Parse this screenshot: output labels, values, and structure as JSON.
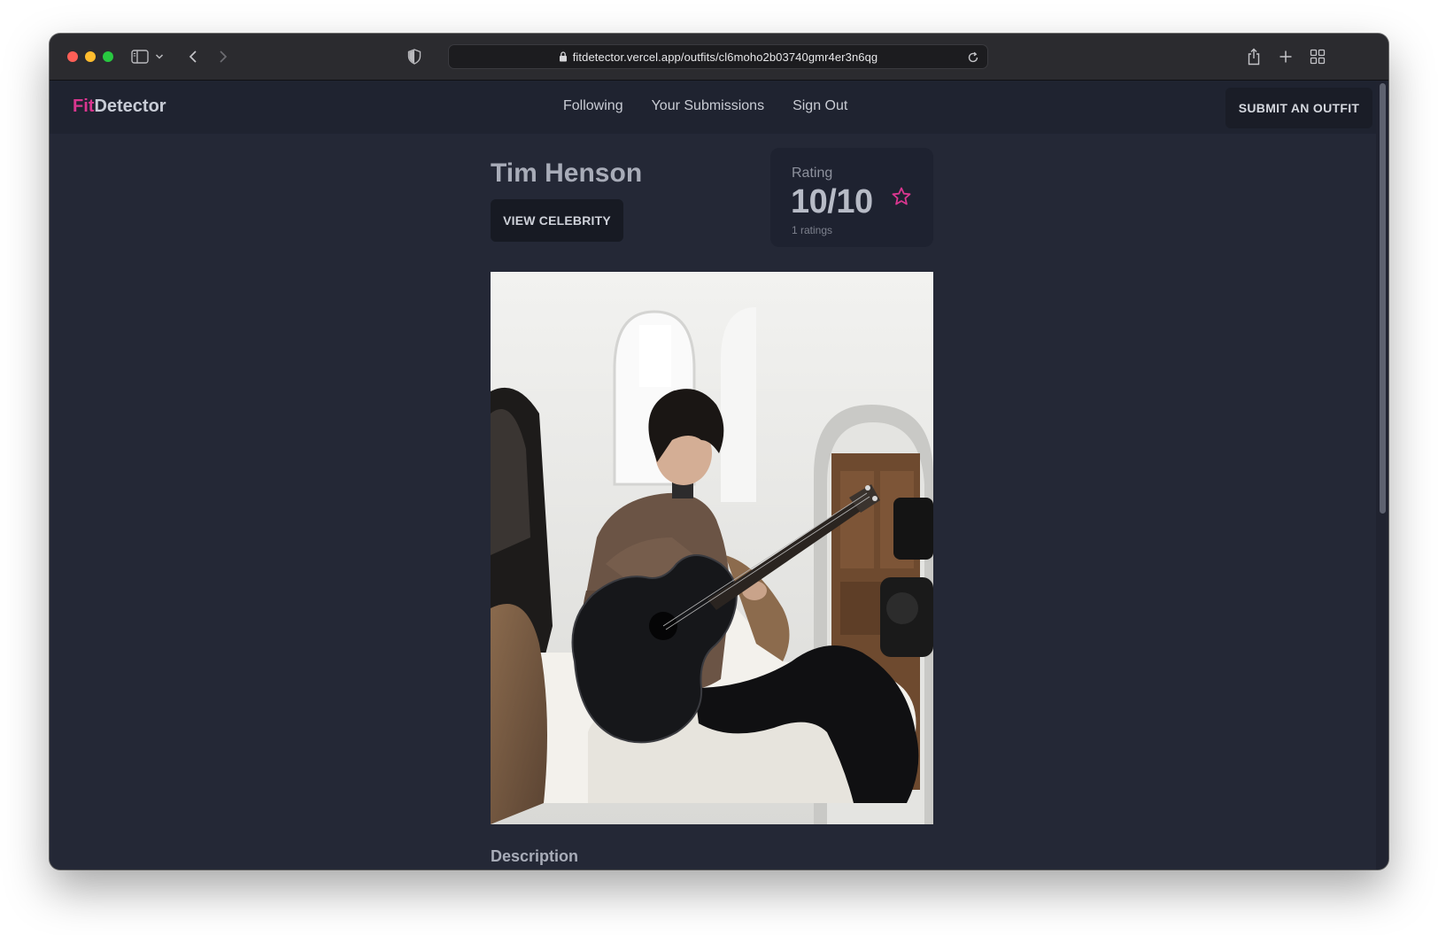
{
  "browser": {
    "url": "fitdetector.vercel.app/outfits/cl6moho2b03740gmr4er3n6qg",
    "icons": [
      "sidebar-icon",
      "chevron-down-icon",
      "back-icon",
      "forward-icon",
      "shield-icon",
      "lock-icon",
      "reload-icon",
      "share-icon",
      "new-tab-icon",
      "tab-overview-icon"
    ]
  },
  "navbar": {
    "logo_accent": "Fit",
    "logo_rest": "Detector",
    "links": [
      {
        "label": "Following"
      },
      {
        "label": "Your Submissions"
      },
      {
        "label": "Sign Out"
      }
    ],
    "submit_label": "SUBMIT AN OUTFIT"
  },
  "outfit": {
    "celebrity_name": "Tim Henson",
    "view_celebrity_label": "VIEW CELEBRITY",
    "rating": {
      "label": "Rating",
      "value": "10/10",
      "count": "1 ratings"
    },
    "description_title": "Description",
    "description_text": ""
  },
  "colors": {
    "accent": "#d9368f",
    "page_bg": "#242836",
    "navbar_bg": "#1f2330"
  }
}
